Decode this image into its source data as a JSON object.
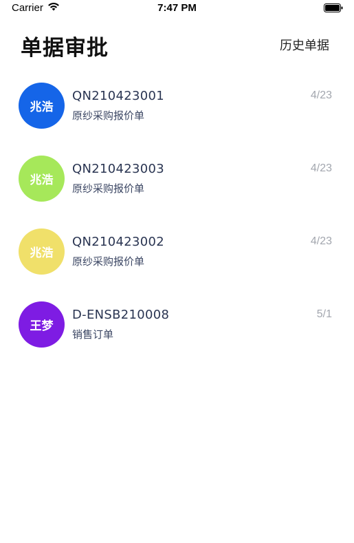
{
  "status_bar": {
    "carrier": "Carrier",
    "time": "7:47 PM"
  },
  "header": {
    "title": "单据审批",
    "history_label": "历史单据"
  },
  "documents": [
    {
      "avatar_text": "兆浩",
      "avatar_color": "#1565e8",
      "code": "QN210423001",
      "type": "原纱采购报价单",
      "date": "4/23"
    },
    {
      "avatar_text": "兆浩",
      "avatar_color": "#a6e85a",
      "code": "QN210423003",
      "type": "原纱采购报价单",
      "date": "4/23"
    },
    {
      "avatar_text": "兆浩",
      "avatar_color": "#f0e06a",
      "code": "QN210423002",
      "type": "原纱采购报价单",
      "date": "4/23"
    },
    {
      "avatar_text": "王梦",
      "avatar_color": "#7e1ce3",
      "code": "D-ENSB210008",
      "type": "销售订单",
      "date": "5/1"
    }
  ]
}
